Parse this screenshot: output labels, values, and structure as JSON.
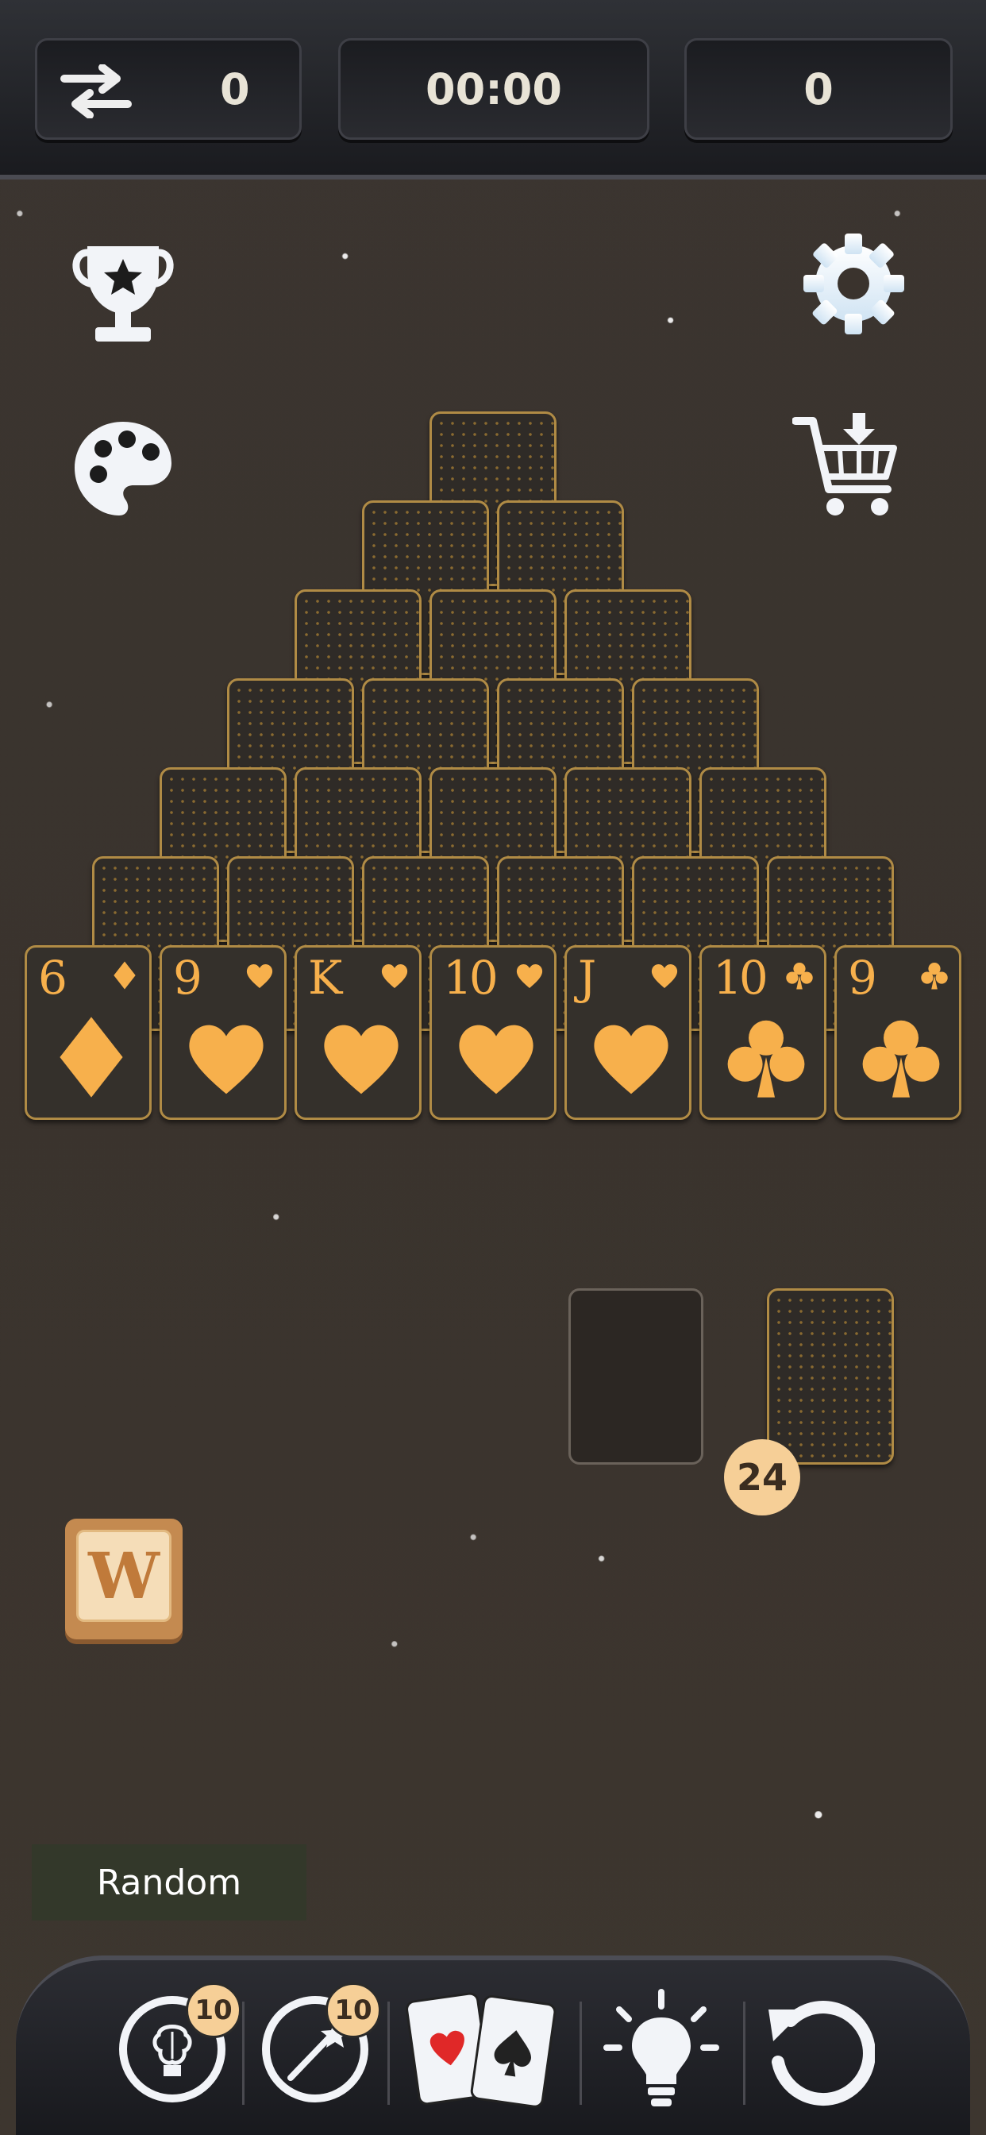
{
  "header": {
    "moves_icon": "swap-arrows-icon",
    "moves": "0",
    "timer": "00:00",
    "score": "0"
  },
  "icons": {
    "trophy": "trophy-icon",
    "settings": "gear-icon",
    "theme": "palette-icon",
    "shop": "cart-icon"
  },
  "board": {
    "face_up_row": [
      {
        "rank": "6",
        "suit": "diamond"
      },
      {
        "rank": "9",
        "suit": "heart"
      },
      {
        "rank": "K",
        "suit": "heart"
      },
      {
        "rank": "10",
        "suit": "heart"
      },
      {
        "rank": "J",
        "suit": "heart"
      },
      {
        "rank": "10",
        "suit": "club"
      },
      {
        "rank": "9",
        "suit": "club"
      }
    ],
    "stock_count": "24"
  },
  "word_tile": {
    "letter": "W"
  },
  "deal_mode": "Random",
  "toolbar": {
    "hint_badge": "10",
    "wand_badge": "10"
  },
  "colors": {
    "card_gold": "#f7b04c",
    "card_border": "#b08b45",
    "badge": "#f6cf97"
  }
}
